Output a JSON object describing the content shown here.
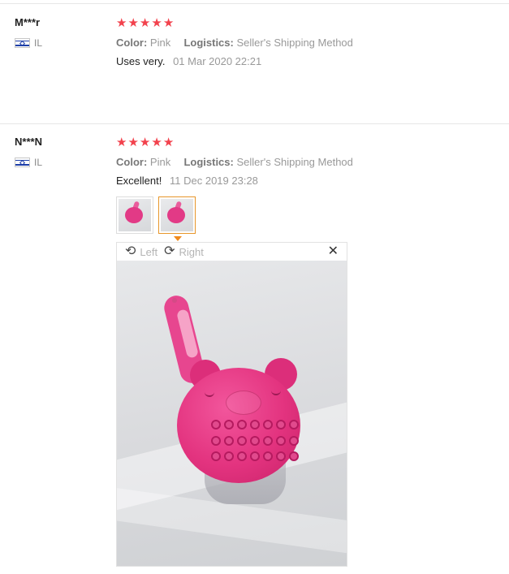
{
  "reviews": [
    {
      "user": "M***r",
      "country": "IL",
      "stars": [
        "★",
        "★",
        "★",
        "★",
        "★"
      ],
      "color_label": "Color:",
      "color_value": "Pink",
      "logistics_label": "Logistics:",
      "logistics_value": "Seller's Shipping Method",
      "text": "Uses very.",
      "date": "01 Mar 2020 22:21"
    },
    {
      "user": "N***N",
      "country": "IL",
      "stars": [
        "★",
        "★",
        "★",
        "★",
        "★"
      ],
      "color_label": "Color:",
      "color_value": "Pink",
      "logistics_label": "Logistics:",
      "logistics_value": "Seller's Shipping Method",
      "text": "Excellent!",
      "date": "11 Dec 2019 23:28",
      "photo_count": 2,
      "selected_photo": 2
    }
  ],
  "viewer": {
    "rotate_left_label": "Left",
    "rotate_right_label": "Right",
    "rotate_left_icon": "⟲",
    "rotate_right_icon": "⟳",
    "close_icon": "✕"
  },
  "colors": {
    "star": "#f2424d",
    "selected_thumb_border": "#e7962b",
    "caret": "#f08a1c",
    "product_pink": "#e3337f"
  }
}
